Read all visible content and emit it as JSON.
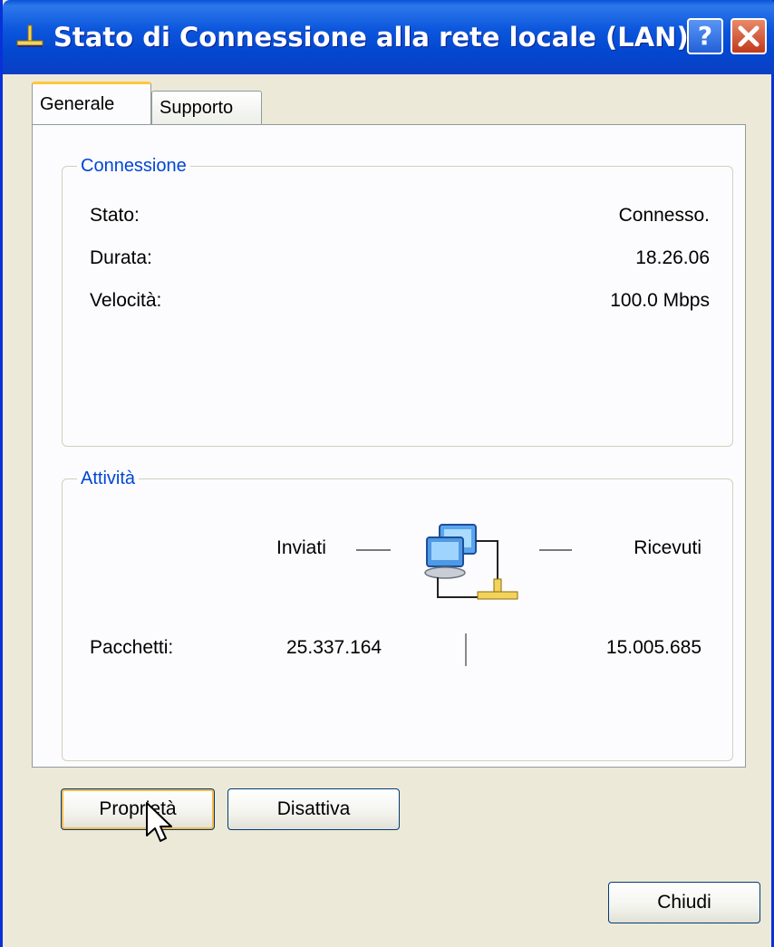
{
  "window": {
    "title": "Stato di Connessione alla rete locale (LAN)",
    "help_label": "?",
    "title_icon": "network-connection-icon"
  },
  "tabs": [
    {
      "label": "Generale",
      "active": true
    },
    {
      "label": "Supporto",
      "active": false
    }
  ],
  "connection": {
    "legend": "Connessione",
    "rows": [
      {
        "label": "Stato:",
        "value": "Connesso."
      },
      {
        "label": "Durata:",
        "value": "18.26.06"
      },
      {
        "label": "Velocità:",
        "value": "100.0 Mbps"
      }
    ]
  },
  "activity": {
    "legend": "Attività",
    "sent_label": "Inviati",
    "received_label": "Ricevuti",
    "packets_label": "Pacchetti:",
    "packets_sent": "25.337.164",
    "packets_received": "15.005.685",
    "icon": "network-computers-icon"
  },
  "buttons": {
    "properties": "Proprietà",
    "disable": "Disattiva",
    "close": "Chiudi"
  },
  "colors": {
    "titlebar": "#0a53d8",
    "group_label": "#0046d5",
    "focus_ring": "#f9b94a",
    "close_button": "#c13a1c"
  }
}
